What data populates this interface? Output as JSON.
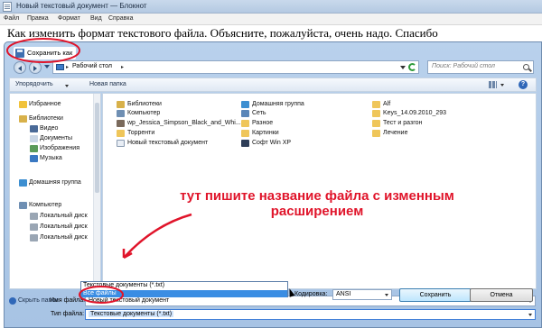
{
  "notepad": {
    "title": "Новый текстовый документ — Блокнот",
    "menu": [
      "Файл",
      "Правка",
      "Формат",
      "Вид",
      "Справка"
    ],
    "body_text": "Как изменить формат текстового файла. Объясните, пожалуйста, очень надо. Спасибо"
  },
  "dialog": {
    "title": "Сохранить как",
    "address": {
      "location": "Рабочий стол"
    },
    "search_placeholder": "Поиск: Рабочий стол",
    "toolbar": {
      "organize": "Упорядочить",
      "new_folder": "Новая папка"
    },
    "nav": {
      "favorites": "Избранное",
      "libraries": "Библиотеки",
      "video": "Видео",
      "documents": "Документы",
      "images": "Изображения",
      "music": "Музыка",
      "homegroup": "Домашняя группа",
      "computer": "Компьютер",
      "local_disk_1": "Локальный диск",
      "local_disk_2": "Локальный диск",
      "local_disk_3": "Локальный диск"
    },
    "files": [
      "Библиотеки",
      "Компьютер",
      "wp_Jessica_Simpson_Black_and_Whi...",
      "Торренти",
      "Новый текстовый документ",
      "Домашняя группа",
      "Сеть",
      "Разное",
      "Картинки",
      "Софт Win XP",
      "Alf",
      "Keys_14.09.2010_293",
      "Тест и разгон",
      "Лечение"
    ],
    "annotation": "тут пишите название файла с изменным расширением",
    "filename": {
      "label": "Имя файла:",
      "value": "Новый текстовый документ"
    },
    "filetype": {
      "label": "Тип файла:",
      "value": "Текстовые документы (*.txt)",
      "options": [
        "Текстовые документы (*.txt)",
        "Все файлы"
      ]
    },
    "hide_folders": "Скрыть папки",
    "encoding": {
      "label": "Кодировка:",
      "value": "ANSI"
    },
    "save_button": "Сохранить",
    "cancel_button": "Отмена"
  }
}
